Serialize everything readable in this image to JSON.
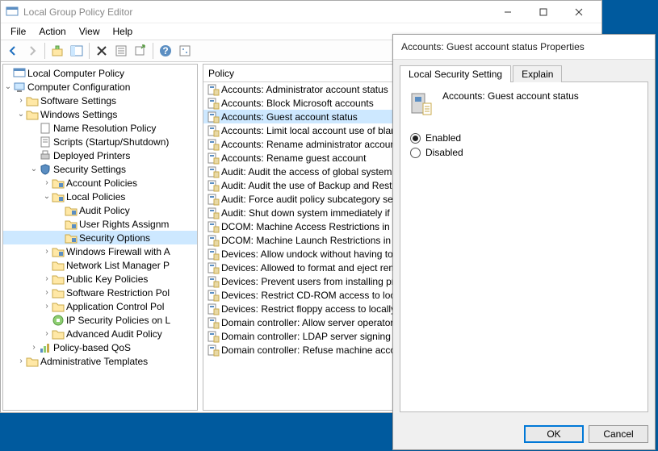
{
  "window": {
    "title": "Local Group Policy Editor",
    "menus": [
      "File",
      "Action",
      "View",
      "Help"
    ]
  },
  "list": {
    "header": "Policy",
    "items": [
      "Accounts: Administrator account status",
      "Accounts: Block Microsoft accounts",
      "Accounts: Guest account status",
      "Accounts: Limit local account use of blan",
      "Accounts: Rename administrator account",
      "Accounts: Rename guest account",
      "Audit: Audit the access of global system o",
      "Audit: Audit the use of Backup and Resto",
      "Audit: Force audit policy subcategory sett",
      "Audit: Shut down system immediately if u",
      "DCOM: Machine Access Restrictions in Se",
      "DCOM: Machine Launch Restrictions in S",
      "Devices: Allow undock without having to",
      "Devices: Allowed to format and eject rem",
      "Devices: Prevent users from installing pri",
      "Devices: Restrict CD-ROM access to locall",
      "Devices: Restrict floppy access to locally l",
      "Domain controller: Allow server operators",
      "Domain controller: LDAP server signing re",
      "Domain controller: Refuse machine accou"
    ],
    "selected_index": 2
  },
  "tree": {
    "items": [
      {
        "indent": 0,
        "exp": "",
        "icon": "console",
        "label": "Local Computer Policy",
        "sel": false
      },
      {
        "indent": 0,
        "exp": "v",
        "icon": "computer",
        "label": "Computer Configuration",
        "sel": false
      },
      {
        "indent": 1,
        "exp": ">",
        "icon": "folder",
        "label": "Software Settings",
        "sel": false
      },
      {
        "indent": 1,
        "exp": "v",
        "icon": "folder",
        "label": "Windows Settings",
        "sel": false
      },
      {
        "indent": 2,
        "exp": "",
        "icon": "page",
        "label": "Name Resolution Policy",
        "sel": false
      },
      {
        "indent": 2,
        "exp": "",
        "icon": "script",
        "label": "Scripts (Startup/Shutdown)",
        "sel": false
      },
      {
        "indent": 2,
        "exp": "",
        "icon": "printer",
        "label": "Deployed Printers",
        "sel": false
      },
      {
        "indent": 2,
        "exp": "v",
        "icon": "security",
        "label": "Security Settings",
        "sel": false
      },
      {
        "indent": 3,
        "exp": ">",
        "icon": "folder-sec",
        "label": "Account Policies",
        "sel": false
      },
      {
        "indent": 3,
        "exp": "v",
        "icon": "folder-sec",
        "label": "Local Policies",
        "sel": false
      },
      {
        "indent": 4,
        "exp": "",
        "icon": "folder-sec",
        "label": "Audit Policy",
        "sel": false
      },
      {
        "indent": 4,
        "exp": "",
        "icon": "folder-sec",
        "label": "User Rights Assignm",
        "sel": false
      },
      {
        "indent": 4,
        "exp": "",
        "icon": "folder-sec",
        "label": "Security Options",
        "sel": true
      },
      {
        "indent": 3,
        "exp": ">",
        "icon": "folder-sec",
        "label": "Windows Firewall with A",
        "sel": false
      },
      {
        "indent": 3,
        "exp": "",
        "icon": "folder",
        "label": "Network List Manager P",
        "sel": false
      },
      {
        "indent": 3,
        "exp": ">",
        "icon": "folder",
        "label": "Public Key Policies",
        "sel": false
      },
      {
        "indent": 3,
        "exp": ">",
        "icon": "folder",
        "label": "Software Restriction Pol",
        "sel": false
      },
      {
        "indent": 3,
        "exp": ">",
        "icon": "folder",
        "label": "Application Control Pol",
        "sel": false
      },
      {
        "indent": 3,
        "exp": "",
        "icon": "ipsec",
        "label": "IP Security Policies on L",
        "sel": false
      },
      {
        "indent": 3,
        "exp": ">",
        "icon": "folder",
        "label": "Advanced Audit Policy",
        "sel": false
      },
      {
        "indent": 2,
        "exp": ">",
        "icon": "qos",
        "label": "Policy-based QoS",
        "sel": false
      },
      {
        "indent": 1,
        "exp": ">",
        "icon": "folder",
        "label": "Administrative Templates",
        "sel": false
      }
    ]
  },
  "dialog": {
    "title": "Accounts: Guest account status Properties",
    "tabs": [
      "Local Security Setting",
      "Explain"
    ],
    "policy_name": "Accounts: Guest account status",
    "options": {
      "enabled": "Enabled",
      "disabled": "Disabled"
    },
    "selected": "enabled",
    "buttons": {
      "ok": "OK",
      "cancel": "Cancel"
    }
  }
}
